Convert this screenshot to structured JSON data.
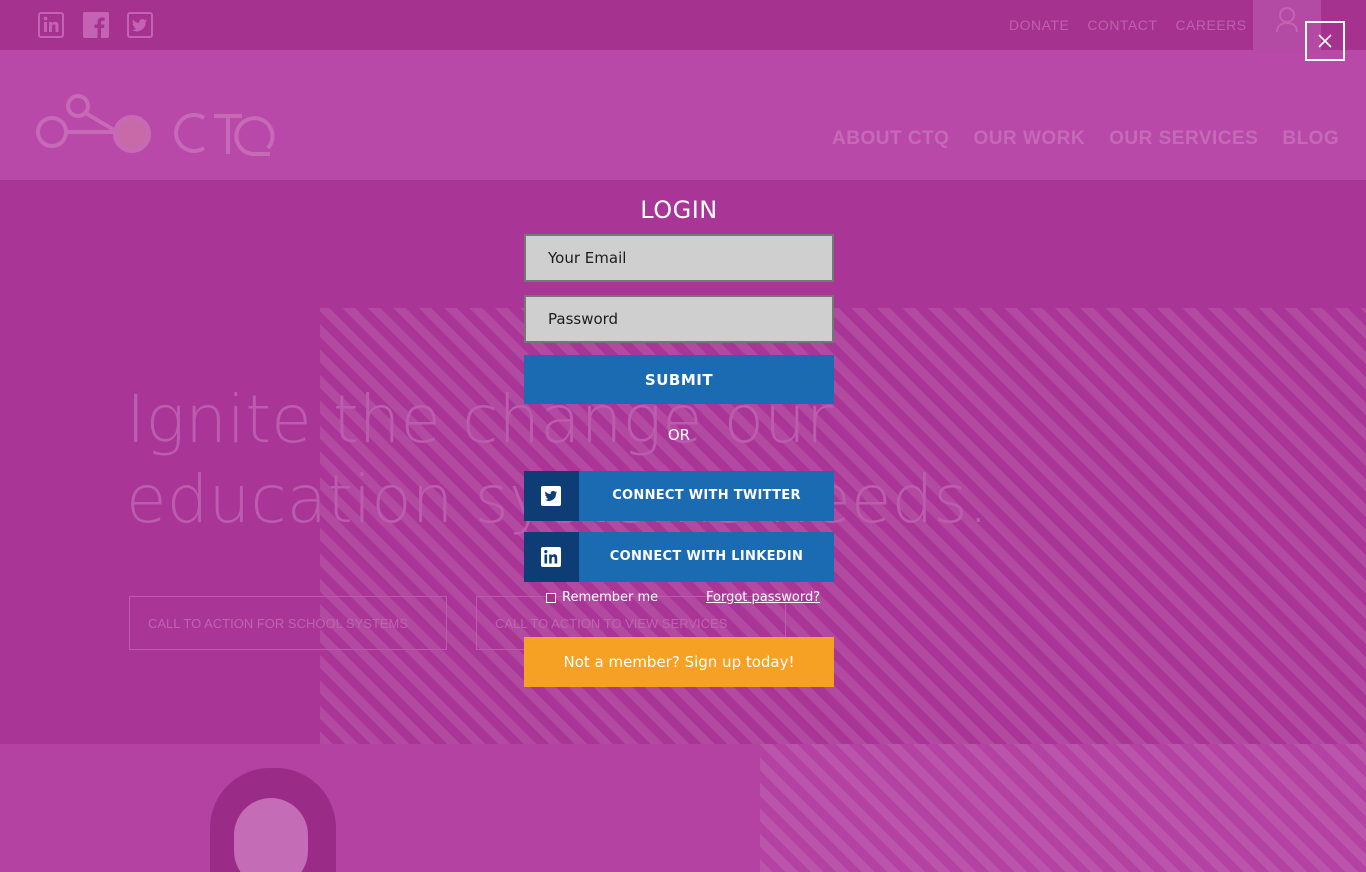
{
  "background": {
    "topbar": {
      "social_icons": [
        "linkedin-icon",
        "facebook-icon",
        "twitter-icon"
      ],
      "links": [
        "DONATE",
        "CONTACT",
        "CAREERS"
      ]
    },
    "nav": [
      "ABOUT CTQ",
      "OUR WORK",
      "OUR SERVICES",
      "BLOG"
    ],
    "logo_text": "CTQ",
    "hero": {
      "headline_line1": "Ignite the change our",
      "headline_line2": "education systems needs.",
      "cta1": "CALL TO ACTION FOR SCHOOL SYSTEMS",
      "cta2": "CALL TO ACTION TO VIEW SERVICES"
    }
  },
  "modal": {
    "title": "LOGIN",
    "email_placeholder": "Your Email",
    "password_placeholder": "Password",
    "submit_label": "SUBMIT",
    "or_label": "OR",
    "twitter_label": "CONNECT WITH TWITTER",
    "linkedin_label": "CONNECT WITH LINKEDIN",
    "remember_label": "Remember me",
    "forgot_label": "Forgot password?",
    "signup_label": "Not a member? Sign up today!"
  },
  "colors": {
    "overlay": "#b13e9e",
    "primary_button": "#1b6bb3",
    "social_icon_bg": "#0e3d75",
    "signup_button": "#f6a124"
  }
}
